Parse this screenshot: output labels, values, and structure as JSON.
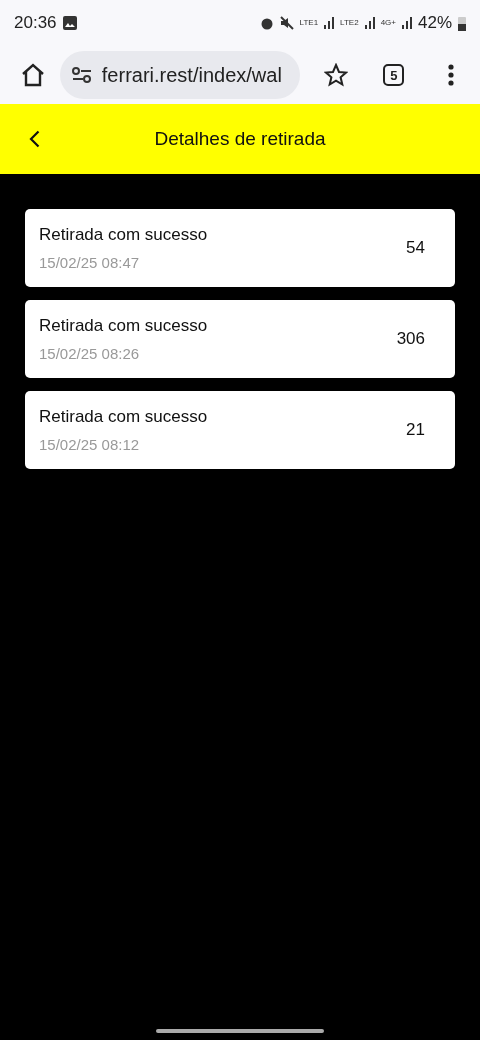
{
  "status_bar": {
    "time": "20:36",
    "network_labels": [
      "LTE1",
      "LTE2",
      "4G+"
    ],
    "battery": "42%"
  },
  "browser": {
    "url": "ferrari.rest/index/wal",
    "tab_count": "5"
  },
  "header": {
    "title": "Detalhes de retirada"
  },
  "withdrawals": [
    {
      "status": "Retirada com sucesso",
      "date": "15/02/25 08:47",
      "amount": "54"
    },
    {
      "status": "Retirada com sucesso",
      "date": "15/02/25 08:26",
      "amount": "306"
    },
    {
      "status": "Retirada com sucesso",
      "date": "15/02/25 08:12",
      "amount": "21"
    }
  ]
}
